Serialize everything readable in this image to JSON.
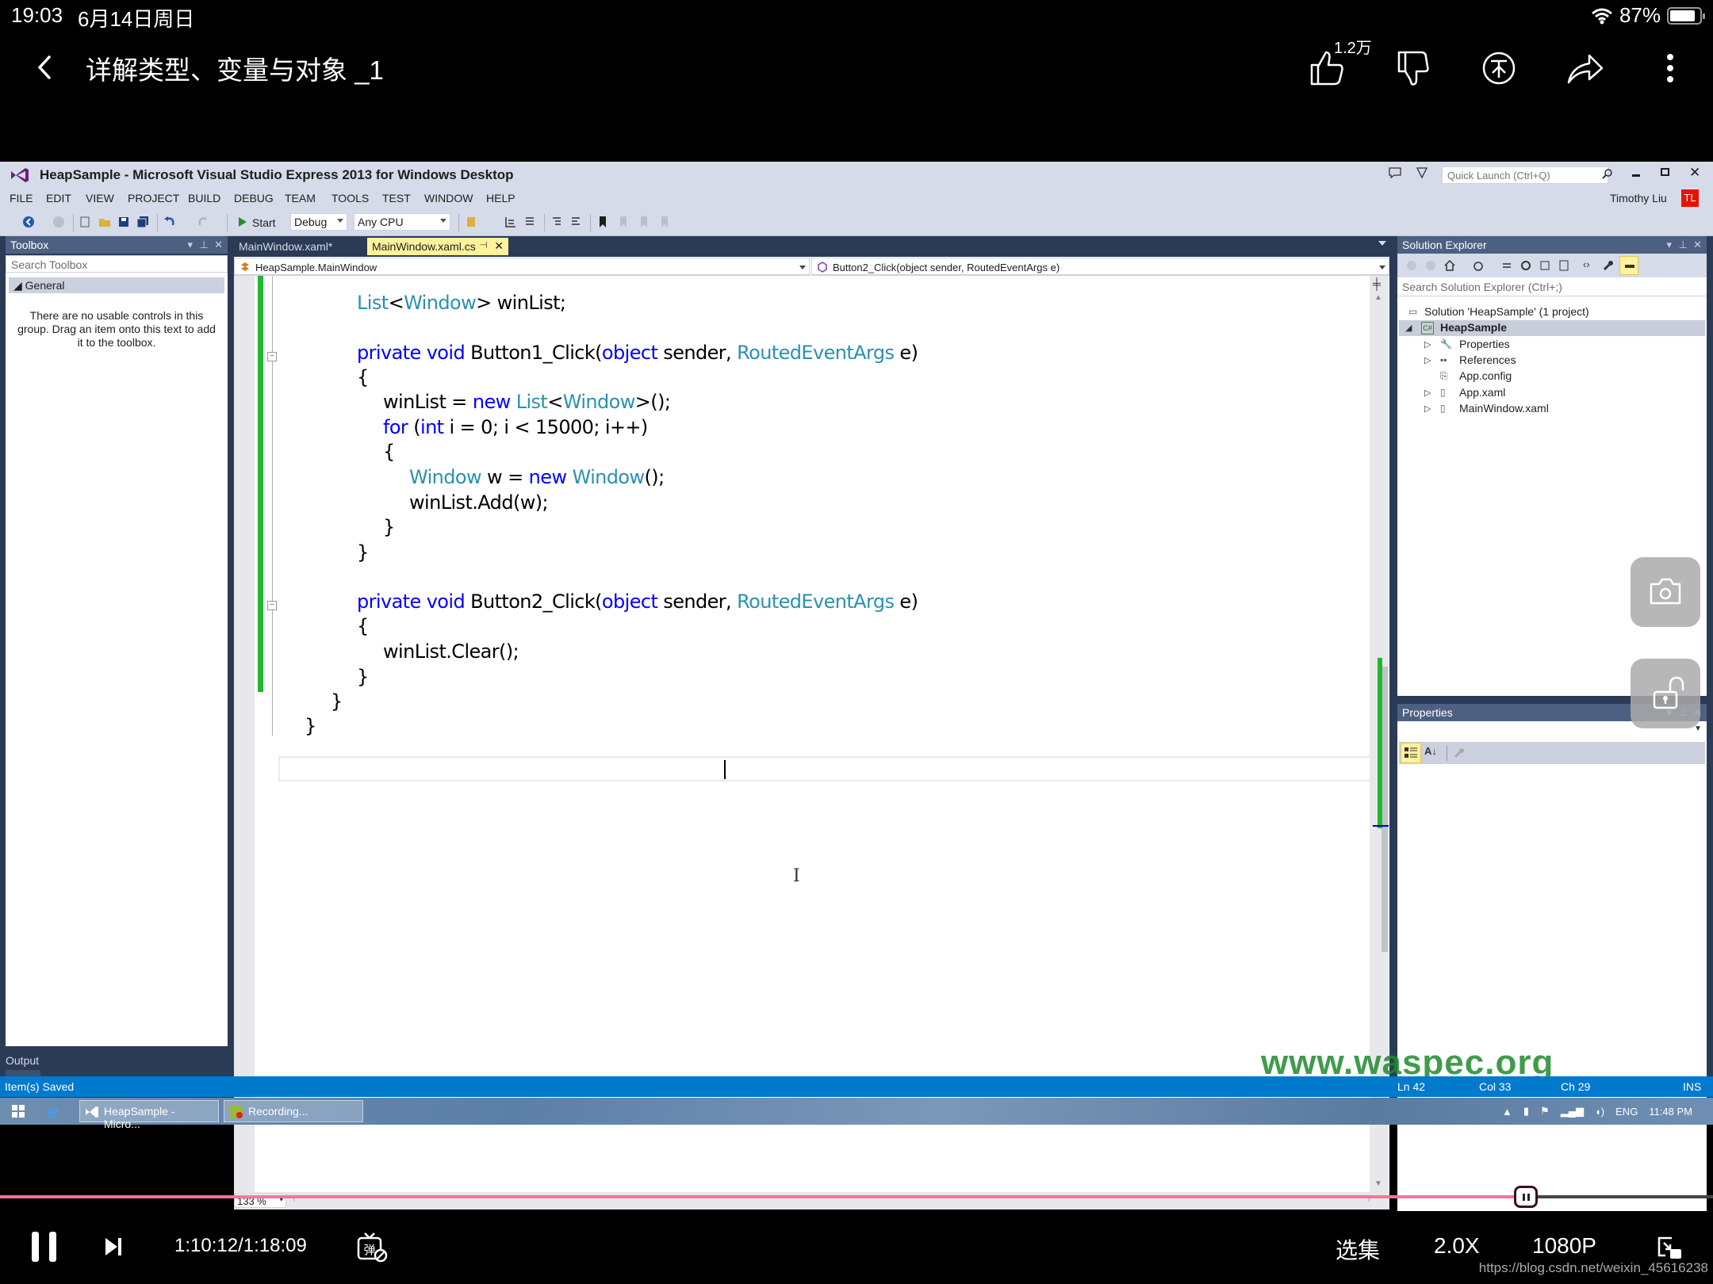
{
  "phone_status": {
    "time": "19:03",
    "date": "6月14日周日",
    "battery_percent": "87%",
    "battery_level": 0.87,
    "wifi_icon": "wifi-icon"
  },
  "video_header": {
    "title": "详解类型、变量与对象 _1",
    "like_count": "1.2万",
    "icons": [
      "back-icon",
      "thumbs-up-icon",
      "thumbs-down-icon",
      "coin-icon",
      "share-icon",
      "more-icon"
    ]
  },
  "vs": {
    "window_title": "HeapSample - Microsoft Visual Studio Express 2013 for Windows Desktop",
    "quick_launch_placeholder": "Quick Launch (Ctrl+Q)",
    "user_name": "Timothy Liu",
    "user_initials": "TL",
    "menu": [
      "FILE",
      "EDIT",
      "VIEW",
      "PROJECT",
      "BUILD",
      "DEBUG",
      "TEAM",
      "TOOLS",
      "TEST",
      "WINDOW",
      "HELP"
    ],
    "toolbar": {
      "start_label": "Start",
      "config_value": "Debug",
      "platform_value": "Any CPU"
    },
    "toolbox": {
      "title": "Toolbox",
      "search_placeholder": "Search Toolbox",
      "group": "General",
      "empty_message": "There are no usable controls in this group. Drag an item onto this text to add it to the toolbox."
    },
    "tabs": [
      {
        "label": "MainWindow.xaml*",
        "active": false
      },
      {
        "label": "MainWindow.xaml.cs",
        "active": true
      }
    ],
    "nav": {
      "class_value": "HeapSample.MainWindow",
      "member_value": "Button2_Click(object sender, RoutedEventArgs e)"
    },
    "code_lines": [
      [
        {
          "t": "List",
          "c": "ty"
        },
        {
          "t": "<"
        },
        {
          "t": "Window",
          "c": "ty"
        },
        {
          "t": "> winList;"
        }
      ],
      [
        {
          "t": "private",
          "c": "kw"
        },
        {
          "t": " "
        },
        {
          "t": "void",
          "c": "kw"
        },
        {
          "t": " Button1_Click("
        },
        {
          "t": "object",
          "c": "kw"
        },
        {
          "t": " sender, "
        },
        {
          "t": "RoutedEventArgs",
          "c": "ty"
        },
        {
          "t": " e)"
        }
      ],
      [
        {
          "t": "{"
        }
      ],
      [
        {
          "t": "winList = "
        },
        {
          "t": "new",
          "c": "kw"
        },
        {
          "t": " "
        },
        {
          "t": "List",
          "c": "ty"
        },
        {
          "t": "<"
        },
        {
          "t": "Window",
          "c": "ty"
        },
        {
          "t": ">();"
        }
      ],
      [
        {
          "t": "for",
          "c": "kw"
        },
        {
          "t": " ("
        },
        {
          "t": "int",
          "c": "kw"
        },
        {
          "t": " i = 0; i < 15000; i++)"
        }
      ],
      [
        {
          "t": "{"
        }
      ],
      [
        {
          "t": "Window",
          "c": "ty"
        },
        {
          "t": " w = "
        },
        {
          "t": "new",
          "c": "kw"
        },
        {
          "t": " "
        },
        {
          "t": "Window",
          "c": "ty"
        },
        {
          "t": "();"
        }
      ],
      [
        {
          "t": "winList.Add(w);"
        }
      ],
      [
        {
          "t": "}"
        }
      ],
      [
        {
          "t": "}"
        }
      ],
      [
        {
          "t": "private",
          "c": "kw"
        },
        {
          "t": " "
        },
        {
          "t": "void",
          "c": "kw"
        },
        {
          "t": " Button2_Click("
        },
        {
          "t": "object",
          "c": "kw"
        },
        {
          "t": " sender, "
        },
        {
          "t": "RoutedEventArgs",
          "c": "ty"
        },
        {
          "t": " e)"
        }
      ],
      [
        {
          "t": "{"
        }
      ],
      [
        {
          "t": "winList.Clear();"
        }
      ],
      [
        {
          "t": "}"
        }
      ],
      [
        {
          "t": "}"
        }
      ],
      [
        {
          "t": "}"
        }
      ]
    ],
    "zoom_level": "133 %",
    "solution_explorer": {
      "title": "Solution Explorer",
      "search_placeholder": "Search Solution Explorer (Ctrl+;)",
      "tree": [
        {
          "label": "Solution 'HeapSample' (1 project)",
          "icon": "solution-icon",
          "expander": ""
        },
        {
          "label": "HeapSample",
          "icon": "csharp-project-icon",
          "expander": "◢",
          "selected": true
        },
        {
          "label": "Properties",
          "icon": "wrench-icon",
          "expander": "▷"
        },
        {
          "label": "References",
          "icon": "references-icon",
          "expander": "▷"
        },
        {
          "label": "App.config",
          "icon": "config-file-icon",
          "expander": ""
        },
        {
          "label": "App.xaml",
          "icon": "xaml-file-icon",
          "expander": "▷"
        },
        {
          "label": "MainWindow.xaml",
          "icon": "xaml-file-icon",
          "expander": "▷"
        }
      ]
    },
    "properties_title": "Properties",
    "output_label": "Output",
    "status": {
      "message": "Item(s) Saved",
      "ln": "Ln 42",
      "col": "Col 33",
      "ch": "Ch 29",
      "mode": "INS"
    },
    "watermark": "www.waspec.org"
  },
  "taskbar": {
    "buttons": [
      "HeapSample - Micro...",
      "Recording..."
    ],
    "language": "ENG",
    "clock": "11:48 PM"
  },
  "player": {
    "progress": 0.8906,
    "time": "1:10:12/1:18:09",
    "episodes_label": "选集",
    "speed_label": "2.0X",
    "quality_label": "1080P",
    "source_url": "https://blog.csdn.net/weixin_45616238"
  }
}
